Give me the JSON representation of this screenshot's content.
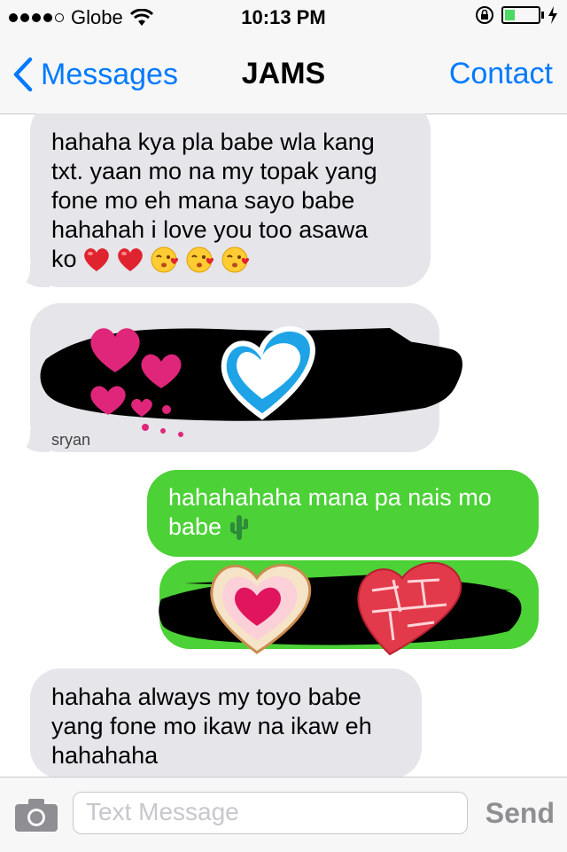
{
  "status_bar": {
    "carrier": "Globe",
    "time": "10:13 PM",
    "signal_bars": 4,
    "battery_level": 0.3
  },
  "nav": {
    "back_label": "Messages",
    "title": "JAMS",
    "contact_label": "Contact"
  },
  "messages": [
    {
      "direction": "incoming",
      "lines": [
        "hahaha kya pla babe wla kang",
        "txt. yaan mo na my topak yang",
        "fone mo eh mana sayo babe",
        "hahahah i love you too asawa"
      ],
      "last_line": "ko",
      "emojis": [
        "red-heart",
        "red-heart",
        "kissing-heart-face",
        "kissing-heart-face",
        "kissing-heart-face"
      ]
    },
    {
      "direction": "incoming",
      "redacted": true
    },
    {
      "direction": "outgoing",
      "lines": [
        "hahahahaha mana pa nais mo",
        "babe"
      ],
      "emojis": [
        "cactus"
      ]
    },
    {
      "direction": "outgoing",
      "redacted": true
    },
    {
      "direction": "incoming",
      "lines": [
        "hahaha always my toyo babe",
        "yang fone mo ikaw na ikaw eh",
        "hahahaha"
      ]
    }
  ],
  "input": {
    "placeholder": "Text Message",
    "send_label": "Send"
  },
  "colors": {
    "incoming_bubble": "#e5e5ea",
    "outgoing_bubble": "#4cd137",
    "ios_blue": "#007aff",
    "battery_green": "#4cd964"
  }
}
